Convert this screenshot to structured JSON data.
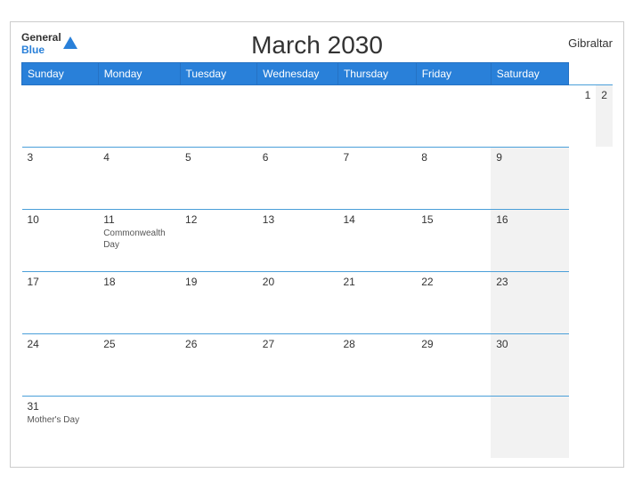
{
  "header": {
    "title": "March 2030",
    "region": "Gibraltar",
    "logo_general": "General",
    "logo_blue": "Blue"
  },
  "weekdays": [
    "Sunday",
    "Monday",
    "Tuesday",
    "Wednesday",
    "Thursday",
    "Friday",
    "Saturday"
  ],
  "rows": [
    [
      {
        "day": "",
        "event": "",
        "shade": false
      },
      {
        "day": "",
        "event": "",
        "shade": false
      },
      {
        "day": "",
        "event": "",
        "shade": false
      },
      {
        "day": "",
        "event": "",
        "shade": false
      },
      {
        "day": "1",
        "event": "",
        "shade": false
      },
      {
        "day": "2",
        "event": "",
        "shade": true
      }
    ],
    [
      {
        "day": "3",
        "event": "",
        "shade": false
      },
      {
        "day": "4",
        "event": "",
        "shade": false
      },
      {
        "day": "5",
        "event": "",
        "shade": false
      },
      {
        "day": "6",
        "event": "",
        "shade": false
      },
      {
        "day": "7",
        "event": "",
        "shade": false
      },
      {
        "day": "8",
        "event": "",
        "shade": false
      },
      {
        "day": "9",
        "event": "",
        "shade": true
      }
    ],
    [
      {
        "day": "10",
        "event": "",
        "shade": false
      },
      {
        "day": "11",
        "event": "Commonwealth Day",
        "shade": false
      },
      {
        "day": "12",
        "event": "",
        "shade": false
      },
      {
        "day": "13",
        "event": "",
        "shade": false
      },
      {
        "day": "14",
        "event": "",
        "shade": false
      },
      {
        "day": "15",
        "event": "",
        "shade": false
      },
      {
        "day": "16",
        "event": "",
        "shade": true
      }
    ],
    [
      {
        "day": "17",
        "event": "",
        "shade": false
      },
      {
        "day": "18",
        "event": "",
        "shade": false
      },
      {
        "day": "19",
        "event": "",
        "shade": false
      },
      {
        "day": "20",
        "event": "",
        "shade": false
      },
      {
        "day": "21",
        "event": "",
        "shade": false
      },
      {
        "day": "22",
        "event": "",
        "shade": false
      },
      {
        "day": "23",
        "event": "",
        "shade": true
      }
    ],
    [
      {
        "day": "24",
        "event": "",
        "shade": false
      },
      {
        "day": "25",
        "event": "",
        "shade": false
      },
      {
        "day": "26",
        "event": "",
        "shade": false
      },
      {
        "day": "27",
        "event": "",
        "shade": false
      },
      {
        "day": "28",
        "event": "",
        "shade": false
      },
      {
        "day": "29",
        "event": "",
        "shade": false
      },
      {
        "day": "30",
        "event": "",
        "shade": true
      }
    ],
    [
      {
        "day": "31",
        "event": "Mother's Day",
        "shade": false
      },
      {
        "day": "",
        "event": "",
        "shade": false
      },
      {
        "day": "",
        "event": "",
        "shade": false
      },
      {
        "day": "",
        "event": "",
        "shade": false
      },
      {
        "day": "",
        "event": "",
        "shade": false
      },
      {
        "day": "",
        "event": "",
        "shade": false
      },
      {
        "day": "",
        "event": "",
        "shade": true
      }
    ]
  ]
}
